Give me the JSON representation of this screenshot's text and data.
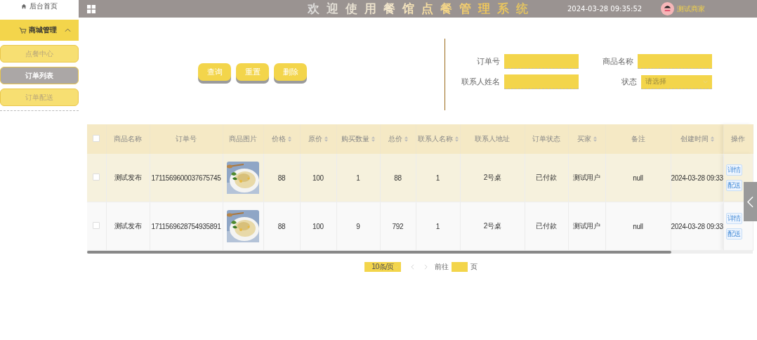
{
  "sidebar": {
    "home": "后台首页",
    "groups": [
      {
        "label": "商城管理",
        "expanded": true,
        "items": [
          {
            "label": "点餐中心",
            "selected": false
          },
          {
            "label": "订单列表",
            "selected": true
          },
          {
            "label": "订单配送",
            "selected": false
          }
        ]
      }
    ]
  },
  "topbar": {
    "title": "欢迎使用餐馆点餐管理系统",
    "datetime": "2024-03-28 09:35:52",
    "user": "测试商家"
  },
  "actions": [
    "查询",
    "重置",
    "删除"
  ],
  "filters": [
    {
      "label": "订单号",
      "kind": "input"
    },
    {
      "label": "商品名称",
      "kind": "input"
    },
    {
      "label": "联系人姓名",
      "kind": "input"
    },
    {
      "label": "状态",
      "kind": "select",
      "placeholder": "请选择"
    }
  ],
  "table": {
    "columns": [
      {
        "kind": "checkbox",
        "checked": false
      },
      {
        "label": "商品名称",
        "sortable": false
      },
      {
        "label": "订单号",
        "sortable": false
      },
      {
        "label": "商品图片",
        "sortable": false
      },
      {
        "label": "价格",
        "sortable": true
      },
      {
        "label": "原价",
        "sortable": true
      },
      {
        "label": "购买数量",
        "sortable": true
      },
      {
        "label": "总价",
        "sortable": true
      },
      {
        "label": "联系人名称",
        "sortable": true
      },
      {
        "label": "联系人地址",
        "sortable": false
      },
      {
        "label": "订单状态",
        "sortable": false
      },
      {
        "label": "买家",
        "sortable": true
      },
      {
        "label": "备注",
        "sortable": false
      },
      {
        "label": "创建时间",
        "sortable": true
      },
      {
        "label": "操作",
        "sortable": false
      }
    ],
    "rows": [
      {
        "hovered": true,
        "cells": [
          {
            "kind": "checkbox",
            "checked": false
          },
          {
            "kind": "text",
            "text": "测试发布"
          },
          {
            "kind": "text",
            "text": "1711569600037675745"
          },
          {
            "kind": "picture"
          },
          {
            "kind": "text",
            "text": "88"
          },
          {
            "kind": "text",
            "text": "100"
          },
          {
            "kind": "text",
            "text": "1"
          },
          {
            "kind": "text",
            "text": "88"
          },
          {
            "kind": "text",
            "text": "1"
          },
          {
            "kind": "text",
            "text": "2号桌"
          },
          {
            "kind": "text",
            "text": "已付款"
          },
          {
            "kind": "text",
            "text": "测试用户"
          },
          {
            "kind": "text",
            "text": "null"
          },
          {
            "kind": "text",
            "text": "2024-03-28 09:33"
          },
          {
            "kind": "actions",
            "buttons": [
              "详情",
              "配送"
            ]
          }
        ]
      },
      {
        "hovered": false,
        "cells": [
          {
            "kind": "checkbox",
            "checked": false
          },
          {
            "kind": "text",
            "text": "测试发布"
          },
          {
            "kind": "text",
            "text": "1711569628754935891"
          },
          {
            "kind": "picture"
          },
          {
            "kind": "text",
            "text": "88"
          },
          {
            "kind": "text",
            "text": "100"
          },
          {
            "kind": "text",
            "text": "9"
          },
          {
            "kind": "text",
            "text": "792"
          },
          {
            "kind": "text",
            "text": "1"
          },
          {
            "kind": "text",
            "text": "2号桌"
          },
          {
            "kind": "text",
            "text": "已付款"
          },
          {
            "kind": "text",
            "text": "测试用户"
          },
          {
            "kind": "text",
            "text": "null"
          },
          {
            "kind": "text",
            "text": "2024-03-28 09:33"
          },
          {
            "kind": "actions",
            "buttons": [
              "详情",
              "配送"
            ]
          }
        ]
      }
    ]
  },
  "pagination": {
    "page_size": "10条/页",
    "goto_label": "前往",
    "page_unit": "页"
  }
}
